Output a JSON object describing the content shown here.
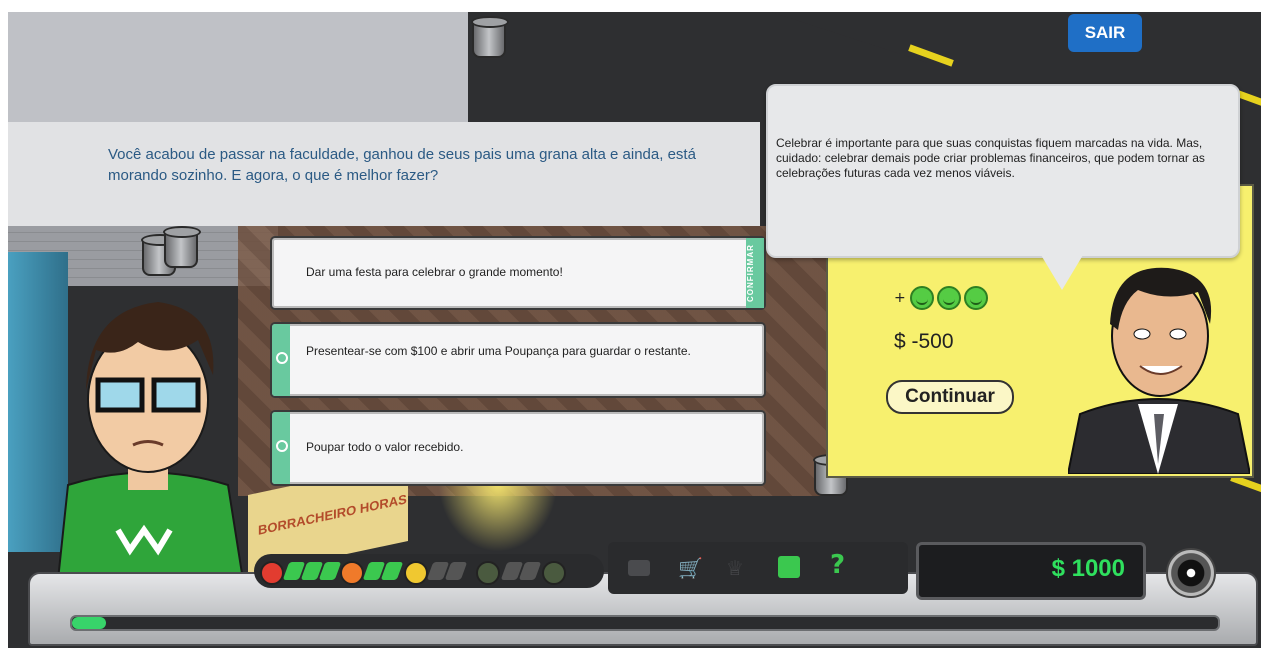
{
  "header": {
    "exit_label": "SAIR"
  },
  "question": {
    "text": "Você acabou de passar na faculdade, ganhou de seus pais uma grana alta e ainda, está morando sozinho. E agora, o que é melhor fazer?"
  },
  "options": [
    {
      "label": "Dar uma festa para celebrar o grande momento!",
      "selected": true
    },
    {
      "label": "Presentear-se com $100 e abrir uma Poupança para guardar o restante.",
      "selected": false
    },
    {
      "label": "Poupar todo o valor recebido.",
      "selected": false
    }
  ],
  "confirm_label": "CONFIRMAR",
  "feedback": {
    "text": "Celebrar é importante para que suas conquistas fiquem marcadas na vida. Mas, cuidado: celebrar demais pode criar problemas financeiros, que podem tornar as celebrações futuras cada vez menos viáveis.",
    "happiness_prefix": "+",
    "happiness_icons": [
      "smiley-icon",
      "smiley-icon",
      "smiley-icon"
    ],
    "money_change": "$ -500",
    "continue_label": "Continuar"
  },
  "hud": {
    "balance": "$ 1000",
    "help_label": "?",
    "mood_level": 0.55,
    "progress": 0.03,
    "icons": [
      "tv-icon",
      "cart-icon",
      "trophy-icon",
      "save-icon",
      "help-icon",
      "music-disc-icon"
    ],
    "colors": {
      "accent_green": "#2fe05e",
      "panel_yellow": "#f7f06e",
      "question_blue": "#2b5a84",
      "exit_blue": "#1f6fc6"
    }
  },
  "scene_sign": "BORRACHEIRO HORAS"
}
